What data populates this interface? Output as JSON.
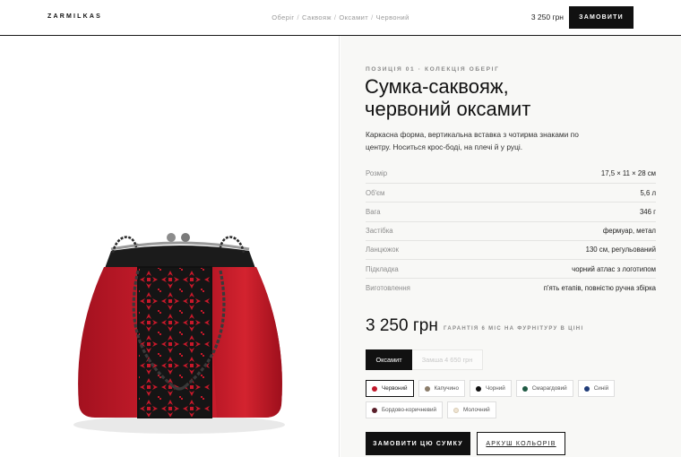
{
  "header": {
    "brand": "ZARMILKAS",
    "breadcrumb": [
      "Оберіг",
      "Саквояж",
      "Оксамит",
      "Червоний"
    ],
    "breadcrumb_separator": "/",
    "price": "3 250 грн",
    "order_label": "ЗАМОВИТИ"
  },
  "product": {
    "eyebrow": "ПОЗИЦІЯ 01 · КОЛЕКЦІЯ ОБЕРІГ",
    "title_line1": "Сумка-саквояж,",
    "title_line2": "червоний оксамит",
    "description": "Каркасна форма, вертикальна вставка з чотирма знаками по центру. Носиться крос-боді, на плечі й у руці.",
    "specs": [
      {
        "label": "Розмір",
        "value": "17,5 × 11 × 28 см"
      },
      {
        "label": "Об'єм",
        "value": "5,6 л"
      },
      {
        "label": "Вага",
        "value": "346 г"
      },
      {
        "label": "Застібка",
        "value": "фермуар, метал"
      },
      {
        "label": "Ланцюжок",
        "value": "130 см, регульований"
      },
      {
        "label": "Підкладка",
        "value": "чорний атлас з логотипом"
      },
      {
        "label": "Виготовлення",
        "value": "п'ять етапів, повністю ручна збірка"
      }
    ],
    "price": "3 250 грн",
    "guarantee": "ГАРАНТІЯ 6 МІС НА ФУРНІТУРУ В ЦІНІ",
    "materials": [
      {
        "label": "Оксамит",
        "active": true
      },
      {
        "label": "Замша 4 650 грн",
        "active": false
      }
    ],
    "colors": [
      {
        "label": "Червоний",
        "hex": "#c0182b",
        "selected": true
      },
      {
        "label": "Капучино",
        "hex": "#8b7d6b",
        "selected": false
      },
      {
        "label": "Чорний",
        "hex": "#111111",
        "selected": false
      },
      {
        "label": "Смарагдовий",
        "hex": "#1f5a43",
        "selected": false
      },
      {
        "label": "Синій",
        "hex": "#1f3b78",
        "selected": false
      },
      {
        "label": "Бордово-коричневий",
        "hex": "#5a1f2a",
        "selected": false
      },
      {
        "label": "Молочний",
        "hex": "#efe4d2",
        "selected": false
      }
    ],
    "primary_action": "ЗАМОВИТИ ЦЮ СУМКУ",
    "secondary_action": "АРКУШ КОЛЬОРІВ"
  },
  "colors": {
    "accent_dark": "#111111",
    "bag_red": "#c21a2a",
    "embroidery_black": "#151515"
  }
}
